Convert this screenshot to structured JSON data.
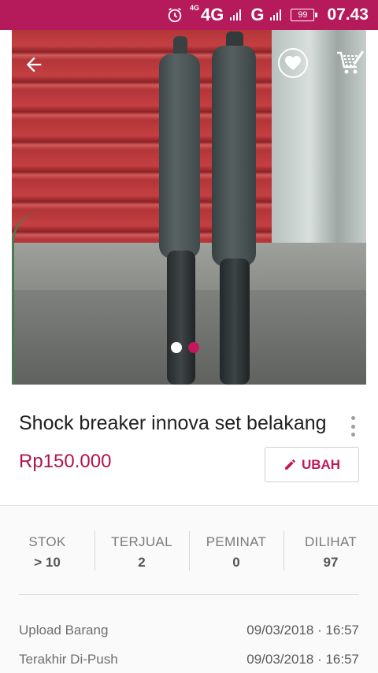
{
  "status_bar": {
    "network": "4G",
    "network_small": "4G",
    "network2": "G",
    "battery": "99",
    "time": "07.43"
  },
  "gallery": {
    "image_count": 2,
    "active_index": 1,
    "icons": [
      "back-arrow-icon",
      "heart-icon",
      "share-cart-icon"
    ]
  },
  "product": {
    "title": "Shock breaker innova set belakang",
    "price": "Rp150.000",
    "edit_label": "UBAH"
  },
  "stats": [
    {
      "label": "STOK",
      "value": "> 10"
    },
    {
      "label": "TERJUAL",
      "value": "2"
    },
    {
      "label": "PEMINAT",
      "value": "0"
    },
    {
      "label": "DILIHAT",
      "value": "97"
    }
  ],
  "info": [
    {
      "label": "Upload Barang",
      "value": "09/03/2018 · 16:57"
    },
    {
      "label": "Terakhir Di-Push",
      "value": "09/03/2018 · 16:57"
    }
  ],
  "colors": {
    "status_bar": "#b51a5a",
    "accent": "#c2185b",
    "price": "#b0144e"
  }
}
